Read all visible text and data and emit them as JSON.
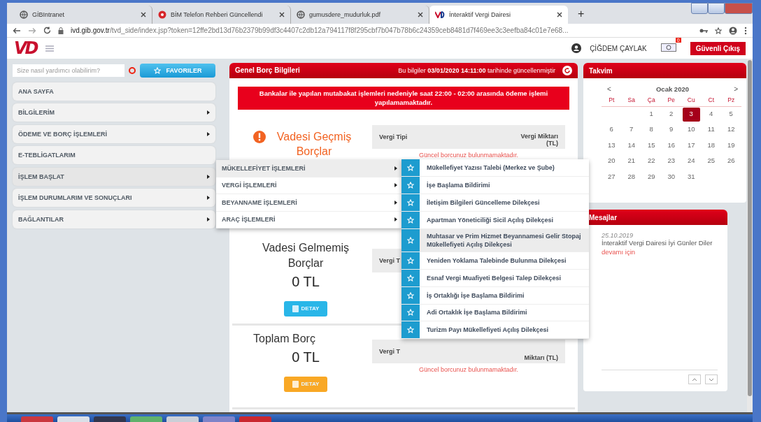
{
  "browser": {
    "tabs": [
      {
        "title": "GİBIntranet",
        "selected": false
      },
      {
        "title": "BİM Telefon Rehberi Güncellendi",
        "selected": false
      },
      {
        "title": "gumusdere_mudurluk.pdf",
        "selected": false
      },
      {
        "title": "İnteraktif Vergi Dairesi",
        "selected": true
      }
    ],
    "new_tab": "+",
    "address": "**ivd.gib.gov.tr**/tvd_side/index.jsp?token=12ffe2bd13d76b2379b99df3c4407c2db12a794117f8f295cbf7b047b78b6c24359ceb8481d7f469ee3c3eefba84c01e7e68..."
  },
  "header": {
    "logo": "VD",
    "user": "ÇİĞDEM ÇAYLAK",
    "mail_badge": "0",
    "logout": "Güvenli Çıkış"
  },
  "sidebar": {
    "search": {
      "placeholder": "Size nasıl yardımcı olabilirim?"
    },
    "favorites": "FAVORILER",
    "items": [
      {
        "label": "ANA SAYFA",
        "has_submenu": false,
        "expanded": false
      },
      {
        "label": "BİLGİLERİM",
        "has_submenu": true,
        "expanded": false
      },
      {
        "label": "ÖDEME VE BORÇ İŞLEMLERİ",
        "has_submenu": true,
        "expanded": false
      },
      {
        "label": "E-TEBLİGATLARIM",
        "has_submenu": false,
        "expanded": false
      },
      {
        "label": "İŞLEM BAŞLAT",
        "has_submenu": true,
        "expanded": true
      },
      {
        "label": "İŞLEM DURUMLARIM VE SONUÇLARI",
        "has_submenu": true,
        "expanded": false
      },
      {
        "label": "BAĞLANTILAR",
        "has_submenu": true,
        "expanded": false
      }
    ]
  },
  "submenu": [
    {
      "label": "MÜKELLEFİYET İŞLEMLERİ",
      "selected": true
    },
    {
      "label": "VERGİ İŞLEMLERİ",
      "selected": false
    },
    {
      "label": "BEYANNAME İŞLEMLERİ",
      "selected": false
    },
    {
      "label": "ARAÇ İŞLEMLERİ",
      "selected": false
    }
  ],
  "actions": [
    {
      "label": "Mükellefiyet Yazısı Talebi (Merkez ve Şube)",
      "selected": false
    },
    {
      "label": "İşe Başlama Bildirimi",
      "selected": false
    },
    {
      "label": "İletişim Bilgileri Güncelleme Dilekçesi",
      "selected": false
    },
    {
      "label": "Apartman Yöneticiliği Sicil Açılış Dilekçesi",
      "selected": false
    },
    {
      "label": "Muhtasar ve Prim Hizmet Beyannamesi Gelir Stopaj Mükellefiyeti Açılış Dilekçesi",
      "selected": true
    },
    {
      "label": "Yeniden Yoklama Talebinde Bulunma Dilekçesi",
      "selected": false
    },
    {
      "label": "Esnaf Vergi Muafiyeti Belgesi Talep Dilekçesi",
      "selected": false
    },
    {
      "label": "İş Ortaklığı İşe Başlama Bildirimi",
      "selected": false
    },
    {
      "label": "Adi Ortaklık İşe Başlama Bildirimi",
      "selected": false
    },
    {
      "label": "Turizm Payı Mükellefiyeti Açılış Dilekçesi",
      "selected": false
    }
  ],
  "debt": {
    "title": "Genel Borç Bilgileri",
    "updated": "Bu bilgiler **03/01/2020 14:11:00** tarihinde güncellenmiştir",
    "alert": "Bankalar ile yapılan mutabakat işlemleri nedeniyle saat 22:00 - 02:00 arasında ödeme işlemi yapılamamaktadır.",
    "sections": [
      {
        "kind": "overdue",
        "title": "Vadesi Geçmiş Borçlar",
        "col_1": "Vergi Tipi",
        "col_2": "Vergi Miktarı (TL)",
        "message": "Güncel borcunuz bulunmamaktadır."
      },
      {
        "kind": "upcoming",
        "title": "Vadesi Gelmemiş Borçlar",
        "amount": "0 TL",
        "button": "DETAY",
        "col_1": "Vergi T"
      },
      {
        "kind": "total",
        "title": "Toplam Borç",
        "amount": "0 TL",
        "button": "DETAY",
        "col_1": "Vergi T",
        "col_2": "Miktarı (TL)",
        "message": "Güncel borcunuz bulunmamaktadır."
      }
    ]
  },
  "calendar": {
    "title": "Takvim",
    "prev": "<",
    "month": "Ocak 2020",
    "next": ">",
    "weekdays": [
      "Pt",
      "Sa",
      "Ça",
      "Pe",
      "Cu",
      "Ct",
      "Pz"
    ],
    "weeks": [
      {
        "kind": "first",
        "days": [
          {
            "label": "1",
            "selected": false
          },
          {
            "label": "2",
            "selected": false
          },
          {
            "label": "3",
            "selected": true
          },
          {
            "label": "4",
            "selected": false
          },
          {
            "label": "5",
            "selected": false
          }
        ]
      },
      {
        "kind": "full",
        "days": [
          {
            "label": "6",
            "selected": false
          },
          {
            "label": "7",
            "selected": false
          },
          {
            "label": "8",
            "selected": false
          },
          {
            "label": "9",
            "selected": false
          },
          {
            "label": "10",
            "selected": false
          },
          {
            "label": "11",
            "selected": false
          },
          {
            "label": "12",
            "selected": false
          }
        ]
      },
      {
        "kind": "full",
        "days": [
          {
            "label": "13",
            "selected": false
          },
          {
            "label": "14",
            "selected": false
          },
          {
            "label": "15",
            "selected": false
          },
          {
            "label": "16",
            "selected": false
          },
          {
            "label": "17",
            "selected": false
          },
          {
            "label": "18",
            "selected": false
          },
          {
            "label": "19",
            "selected": false
          }
        ]
      },
      {
        "kind": "full",
        "days": [
          {
            "label": "20",
            "selected": false
          },
          {
            "label": "21",
            "selected": false
          },
          {
            "label": "22",
            "selected": false
          },
          {
            "label": "23",
            "selected": false
          },
          {
            "label": "24",
            "selected": false
          },
          {
            "label": "25",
            "selected": false
          },
          {
            "label": "26",
            "selected": false
          }
        ]
      },
      {
        "kind": "last",
        "days": [
          {
            "label": "27",
            "selected": false
          },
          {
            "label": "28",
            "selected": false
          },
          {
            "label": "29",
            "selected": false
          },
          {
            "label": "30",
            "selected": false
          },
          {
            "label": "31",
            "selected": false
          }
        ]
      }
    ]
  },
  "messages": {
    "title": "Mesajlar",
    "items": [
      {
        "date": "25.10.2019",
        "text": "İnteraktif Vergi Dairesi İyi Günler Diler",
        "link": "devamı için"
      }
    ]
  }
}
